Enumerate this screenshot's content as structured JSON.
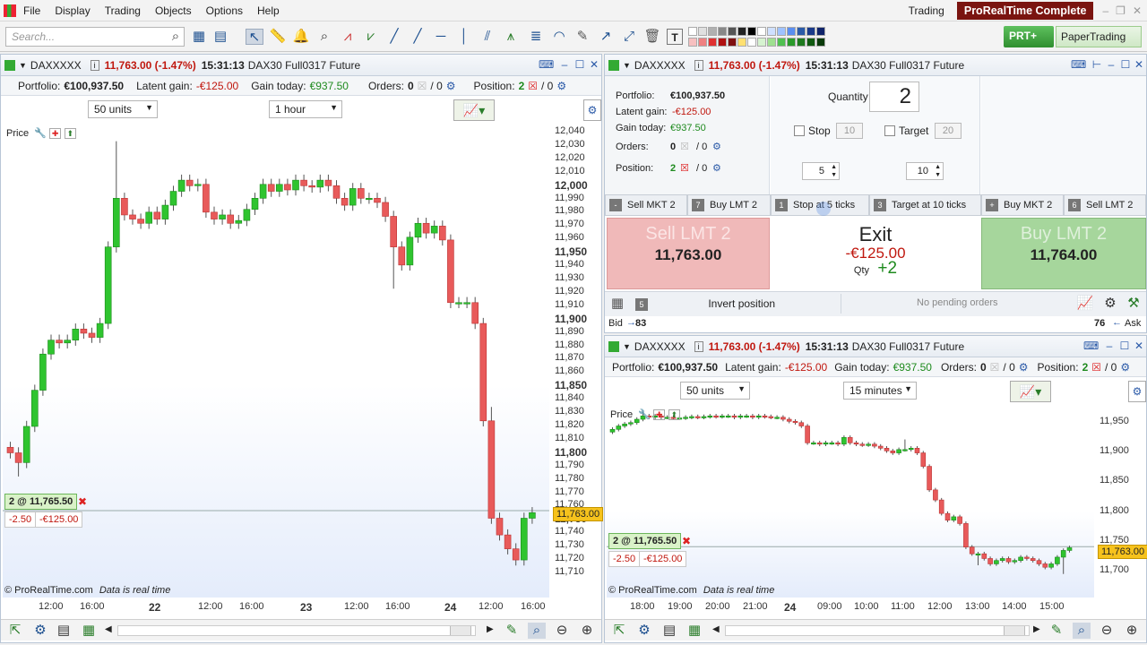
{
  "menu": [
    "File",
    "Display",
    "Trading",
    "Objects",
    "Options",
    "Help"
  ],
  "top_right": {
    "trading": "Trading",
    "brand": "ProRealTime Complete",
    "prt_button": "PRT+",
    "paper_button": "PaperTrading"
  },
  "search": {
    "placeholder": "Search..."
  },
  "instrument": {
    "code": "DAXXXXX",
    "price_change": "11,763.00 (-1.47%)",
    "time": "15:31:13",
    "description": "DAX30 Full0317 Future"
  },
  "portfolio": {
    "portfolio_label": "Portfolio:",
    "portfolio_value": "€100,937.50",
    "latent_label": "Latent gain:",
    "latent_value": "-€125.00",
    "today_label": "Gain today:",
    "today_value": "€937.50",
    "orders_label": "Orders:",
    "orders_value": "0",
    "orders_slash": "/ 0",
    "position_label": "Position:",
    "position_value": "2",
    "position_slash": "/ 0"
  },
  "chart_left": {
    "units_select": "50 units",
    "timeframe_select": "1 hour",
    "price_label": "Price",
    "position_box": "2 @ 11,765.50",
    "pnl_points": "-2.50",
    "pnl_value": "-€125.00",
    "current_price": "11,763.00",
    "footer_brand": "© ProRealTime.com",
    "footer_note": "Data is real time",
    "yticks": [
      {
        "v": "12,040",
        "b": false
      },
      {
        "v": "12,030",
        "b": false
      },
      {
        "v": "12,020",
        "b": false
      },
      {
        "v": "12,010",
        "b": false
      },
      {
        "v": "12,000",
        "b": true
      },
      {
        "v": "11,990",
        "b": false
      },
      {
        "v": "11,980",
        "b": false
      },
      {
        "v": "11,970",
        "b": false
      },
      {
        "v": "11,960",
        "b": false
      },
      {
        "v": "11,950",
        "b": true
      },
      {
        "v": "11,940",
        "b": false
      },
      {
        "v": "11,930",
        "b": false
      },
      {
        "v": "11,920",
        "b": false
      },
      {
        "v": "11,910",
        "b": false
      },
      {
        "v": "11,900",
        "b": true
      },
      {
        "v": "11,890",
        "b": false
      },
      {
        "v": "11,880",
        "b": false
      },
      {
        "v": "11,870",
        "b": false
      },
      {
        "v": "11,860",
        "b": false
      },
      {
        "v": "11,850",
        "b": true
      },
      {
        "v": "11,840",
        "b": false
      },
      {
        "v": "11,830",
        "b": false
      },
      {
        "v": "11,820",
        "b": false
      },
      {
        "v": "11,810",
        "b": false
      },
      {
        "v": "11,800",
        "b": true
      },
      {
        "v": "11,790",
        "b": false
      },
      {
        "v": "11,780",
        "b": false
      },
      {
        "v": "11,770",
        "b": false
      },
      {
        "v": "11,760",
        "b": false
      },
      {
        "v": "11,750",
        "b": true
      },
      {
        "v": "11,740",
        "b": false
      },
      {
        "v": "11,730",
        "b": false
      },
      {
        "v": "11,720",
        "b": false
      },
      {
        "v": "11,710",
        "b": false
      }
    ],
    "xticks": [
      {
        "v": "12:00",
        "b": false
      },
      {
        "v": "16:00",
        "b": false
      },
      {
        "v": "22",
        "b": true
      },
      {
        "v": "12:00",
        "b": false
      },
      {
        "v": "16:00",
        "b": false
      },
      {
        "v": "23",
        "b": true
      },
      {
        "v": "12:00",
        "b": false
      },
      {
        "v": "16:00",
        "b": false
      },
      {
        "v": "24",
        "b": true
      },
      {
        "v": "12:00",
        "b": false
      },
      {
        "v": "16:00",
        "b": false
      }
    ]
  },
  "order_panel": {
    "quantity_label": "Quantity",
    "quantity_value": "2",
    "stop_label": "Stop",
    "stop_value": "10",
    "target_label": "Target",
    "target_value": "20",
    "stepper_left": "5",
    "stepper_right": "10",
    "tabs": [
      {
        "key": "-",
        "label": "Sell MKT 2"
      },
      {
        "key": "7",
        "label": "Buy LMT 2"
      },
      {
        "key": "1",
        "label": "Stop at 5 ticks"
      },
      {
        "key": "3",
        "label": "Target at 10 ticks"
      },
      {
        "key": "+",
        "label": "Buy MKT 2"
      },
      {
        "key": "6",
        "label": "Sell LMT 2"
      }
    ],
    "sell_title": "Sell LMT 2",
    "sell_price": "11,763.00",
    "exit_title": "Exit",
    "exit_value": "-€125.00",
    "qty_label": "Qty",
    "qty_value": "+2",
    "buy_title": "Buy LMT 2",
    "buy_price": "11,764.00",
    "invert_key": "5",
    "invert_label": "Invert position",
    "pending_label": "No pending orders",
    "bid_label": "Bid",
    "bid_value": "83",
    "ask_value": "76",
    "ask_label": "Ask"
  },
  "chart_right": {
    "units_select": "50 units",
    "timeframe_select": "15 minutes",
    "price_label": "Price",
    "position_box": "2 @ 11,765.50",
    "pnl_points": "-2.50",
    "pnl_value": "-€125.00",
    "current_price": "11,763.00",
    "footer_brand": "© ProRealTime.com",
    "footer_note": "Data is real time",
    "yticks": [
      "11,950",
      "11,900",
      "11,850",
      "11,800",
      "11,750",
      "11,700"
    ],
    "xticks": [
      {
        "v": "18:00",
        "b": false
      },
      {
        "v": "19:00",
        "b": false
      },
      {
        "v": "20:00",
        "b": false
      },
      {
        "v": "21:00",
        "b": false
      },
      {
        "v": "24",
        "b": true
      },
      {
        "v": "09:00",
        "b": false
      },
      {
        "v": "10:00",
        "b": false
      },
      {
        "v": "11:00",
        "b": false
      },
      {
        "v": "12:00",
        "b": false
      },
      {
        "v": "13:00",
        "b": false
      },
      {
        "v": "14:00",
        "b": false
      },
      {
        "v": "15:00",
        "b": false
      }
    ]
  },
  "colors": {
    "up": "#2fc42f",
    "down": "#e85a5a",
    "accent": "#2b5aa8",
    "sell_bg": "#f3b6b6",
    "buy_bg": "#a9d9a0"
  }
}
